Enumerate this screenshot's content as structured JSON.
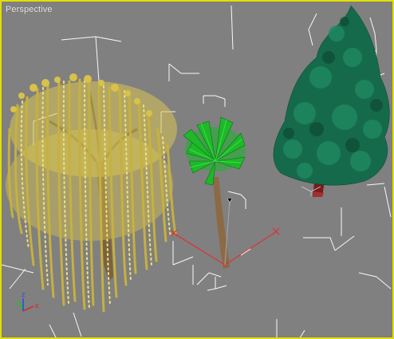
{
  "viewport": {
    "label": "Perspective",
    "frame_color": "#e0e000",
    "background_color": "#808080"
  },
  "scene_objects": [
    {
      "name": "weeping-willow-tree",
      "selected": true,
      "foliage_color": "#e6d35a"
    },
    {
      "name": "palm-tree",
      "selected": true,
      "foliage_color": "#1fb82a"
    },
    {
      "name": "pine-tree",
      "selected": true,
      "foliage_color": "#166a4c"
    }
  ],
  "transform_gizmo": {
    "x_axis_color": "#e03030",
    "y_axis_color": "#e03030",
    "z_axis_color": "#a0a0a0"
  },
  "axis_tripod": {
    "x_color": "#e02020",
    "y_color": "#20c020",
    "z_color": "#2050e0"
  }
}
